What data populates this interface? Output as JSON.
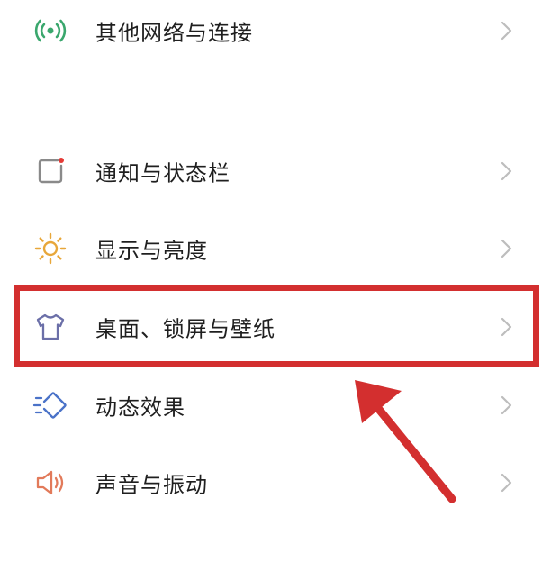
{
  "settings_list": {
    "items": [
      {
        "label": "其他网络与连接",
        "icon": "signal-waves-icon",
        "icon_color": "#3aa76d"
      },
      {
        "label": "通知与状态栏",
        "icon": "notification-square-icon",
        "icon_color": "#9a9a9a"
      },
      {
        "label": "显示与亮度",
        "icon": "sun-icon",
        "icon_color": "#e8a73a"
      },
      {
        "label": "桌面、锁屏与壁纸",
        "icon": "tshirt-icon",
        "icon_color": "#6b6fa8"
      },
      {
        "label": "动态效果",
        "icon": "motion-effects-icon",
        "icon_color": "#4a72c8"
      },
      {
        "label": "声音与振动",
        "icon": "speaker-icon",
        "icon_color": "#e27a5a"
      }
    ]
  },
  "annotation": {
    "highlight_color": "#d32f2f",
    "highlighted_item": "桌面、锁屏与壁纸"
  },
  "colors": {
    "text": "#1f1f1f",
    "chevron": "#bdbdbd",
    "background": "#ffffff"
  }
}
